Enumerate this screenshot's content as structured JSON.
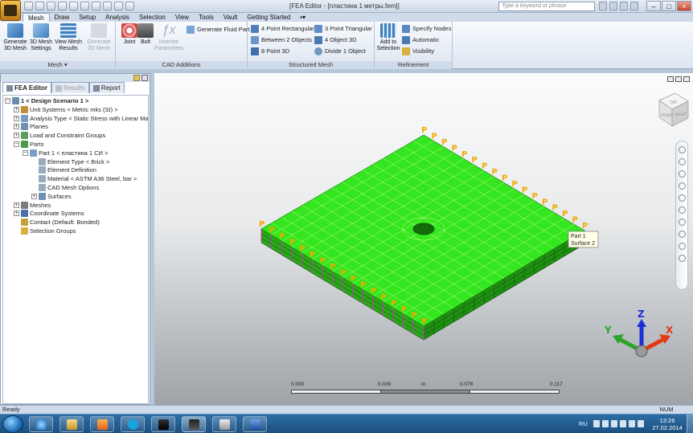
{
  "window": {
    "title": "[FEA Editor - [пластина 1 метры.fem]]",
    "search_placeholder": "Type a keyword or phrase"
  },
  "menu_tabs": [
    "Mesh",
    "Draw",
    "Setup",
    "Analysis",
    "Selection",
    "View",
    "Tools",
    "Vault",
    "Getting Started"
  ],
  "ribbon": {
    "mesh_group": {
      "label": "Mesh",
      "buttons": [
        {
          "line1": "Generate",
          "line2": "3D Mesh"
        },
        {
          "line1": "3D Mesh",
          "line2": "Settings"
        },
        {
          "line1": "View Mesh",
          "line2": "Results"
        },
        {
          "line1": "Generate",
          "line2": "2D Mesh"
        }
      ]
    },
    "cad_group": {
      "label": "CAD Additions",
      "joint": "Joint",
      "bolt": "Bolt",
      "inventor1": "Inventor",
      "inventor2": "Parameters",
      "fluid": "Generate Fluid Part"
    },
    "structured_group": {
      "label": "Structured Mesh",
      "b1": "4 Point Rectangular",
      "b2": "Between 2 Objects",
      "b3": "8 Point 3D",
      "b4": "3 Point Triangular",
      "b5": "4 Object 3D",
      "b6": "Divide 1 Object"
    },
    "refinement_group": {
      "label": "Refinement",
      "add1": "Add to",
      "add2": "Selection",
      "r1": "Specify Nodes",
      "r2": "Automatic",
      "r3": "Visibility"
    }
  },
  "panel": {
    "tabs": [
      "FEA Editor",
      "Results",
      "Report"
    ]
  },
  "tree": [
    {
      "text": "1 < Design Scenario 1 >",
      "indent": 0,
      "exp": "−",
      "icon": "#6a8caf",
      "bold": true
    },
    {
      "text": "Unit Systems < Metric mks (SI) >",
      "indent": 1,
      "exp": "+",
      "icon": "#c58f3a"
    },
    {
      "text": "Analysis Type < Static Stress with Linear Mat",
      "indent": 1,
      "exp": "+",
      "icon": "#7a9bc4"
    },
    {
      "text": "Planes",
      "indent": 1,
      "exp": "+",
      "icon": "#6f8fb3"
    },
    {
      "text": "Load and Constraint Groups",
      "indent": 1,
      "exp": "+",
      "icon": "#5f9c5f"
    },
    {
      "text": "Parts",
      "indent": 1,
      "exp": "−",
      "icon": "#4a9a4a"
    },
    {
      "text": "Part 1 < пластина 1 СИ >",
      "indent": 2,
      "exp": "−",
      "icon": "#7b9ec4"
    },
    {
      "text": "Element Type < Brick >",
      "indent": 3,
      "exp": "",
      "icon": "#9aaac0"
    },
    {
      "text": "Element Definition",
      "indent": 3,
      "exp": "",
      "icon": "#9aaac0"
    },
    {
      "text": "Material < ASTM A36 Steel, bar >",
      "indent": 3,
      "exp": "",
      "icon": "#9aaac0"
    },
    {
      "text": "CAD Mesh Options",
      "indent": 3,
      "exp": "",
      "icon": "#9aaac0"
    },
    {
      "text": "Surfaces",
      "indent": 3,
      "exp": "+",
      "icon": "#6f8fb3"
    },
    {
      "text": "Meshes",
      "indent": 1,
      "exp": "+",
      "icon": "#7c7c7c"
    },
    {
      "text": "Coordinate Systems",
      "indent": 1,
      "exp": "+",
      "icon": "#4b6fa8"
    },
    {
      "text": "Contact (Default: Bonded)",
      "indent": 1,
      "exp": "",
      "icon": "#c8a040"
    },
    {
      "text": "Selection Groups",
      "indent": 1,
      "exp": "",
      "icon": "#d8b040"
    }
  ],
  "viewport": {
    "tooltip_line1": "Part 1",
    "tooltip_line2": "Surface 2",
    "scale": {
      "v0": "0.000",
      "v1": "0.039",
      "unit": "m",
      "v2": "0.078",
      "v3": "0.117"
    },
    "axis": {
      "x": "X",
      "y": "Y",
      "z": "Z"
    },
    "viewcube": {
      "top": "TOP",
      "front": "FRONT",
      "right": "RIGHT"
    },
    "mesh_color": "#33e61f",
    "load_marker": "P",
    "marker_color": "#f2a900"
  },
  "status": {
    "text": "Ready",
    "num": "NUM"
  },
  "taskbar": {
    "lang": "RU",
    "time": "13:26",
    "date": "27.02.2014"
  }
}
